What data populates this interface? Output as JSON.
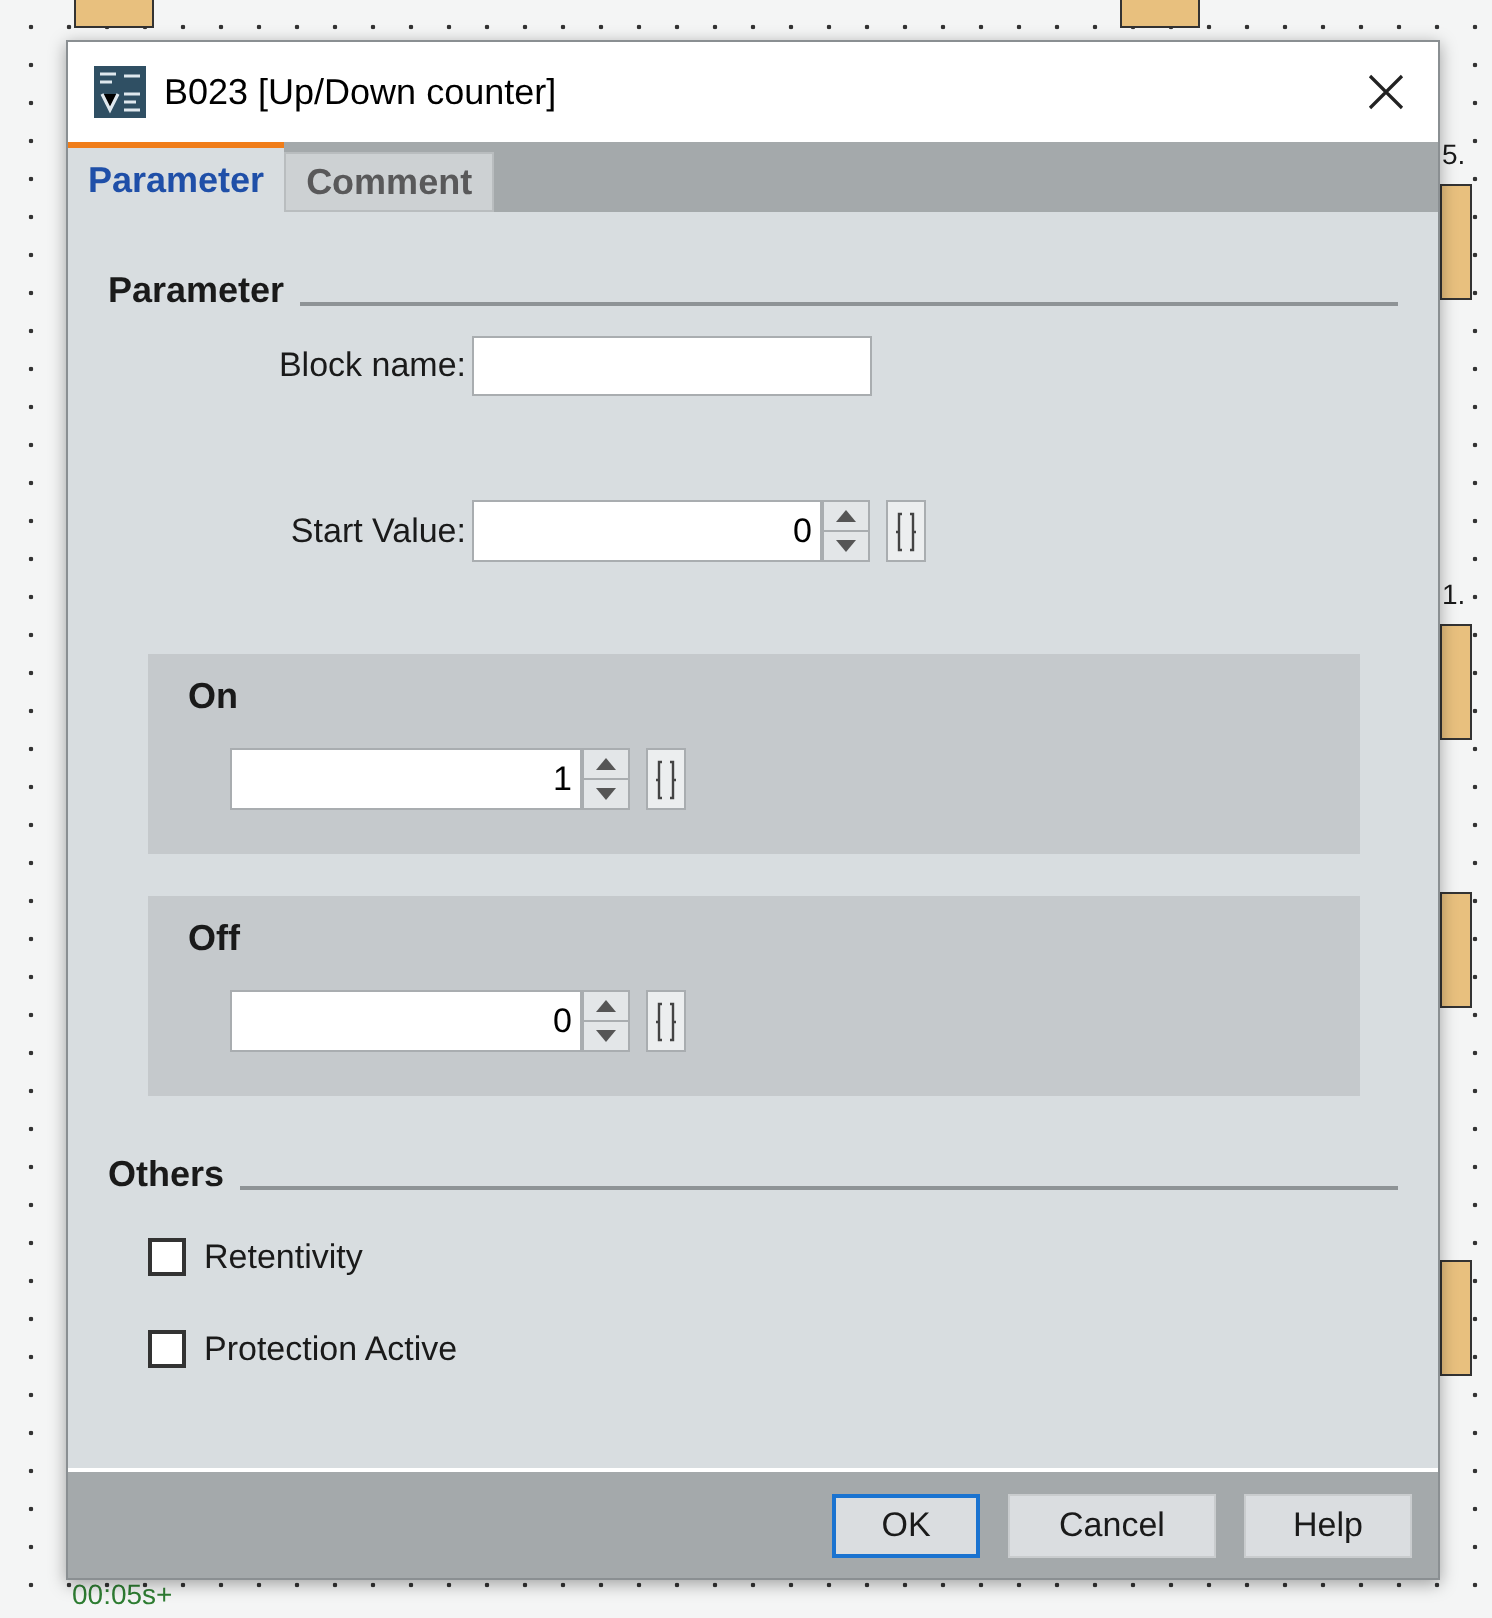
{
  "canvas": {
    "labels": [
      {
        "text": "5.",
        "kind": "number"
      },
      {
        "text": "1.",
        "kind": "number"
      },
      {
        "text": "00:05s+",
        "kind": "timer"
      }
    ]
  },
  "window": {
    "title": "B023 [Up/Down counter]"
  },
  "tabs": [
    {
      "label": "Parameter",
      "selected": true
    },
    {
      "label": "Comment",
      "selected": false
    }
  ],
  "parameter_section": {
    "heading": "Parameter",
    "block_name": {
      "label": "Block name:"
    },
    "start_value": {
      "label": "Start Value:",
      "value": "0"
    }
  },
  "groups": [
    {
      "title": "On",
      "value": "1"
    },
    {
      "title": "Off",
      "value": "0"
    }
  ],
  "others_section": {
    "heading": "Others",
    "checkboxes": [
      {
        "label": "Retentivity",
        "checked": false
      },
      {
        "label": "Protection Active",
        "checked": false
      }
    ]
  },
  "buttons": [
    {
      "label": "OK",
      "default": true
    },
    {
      "label": "Cancel",
      "default": false
    },
    {
      "label": "Help",
      "default": false
    }
  ]
}
